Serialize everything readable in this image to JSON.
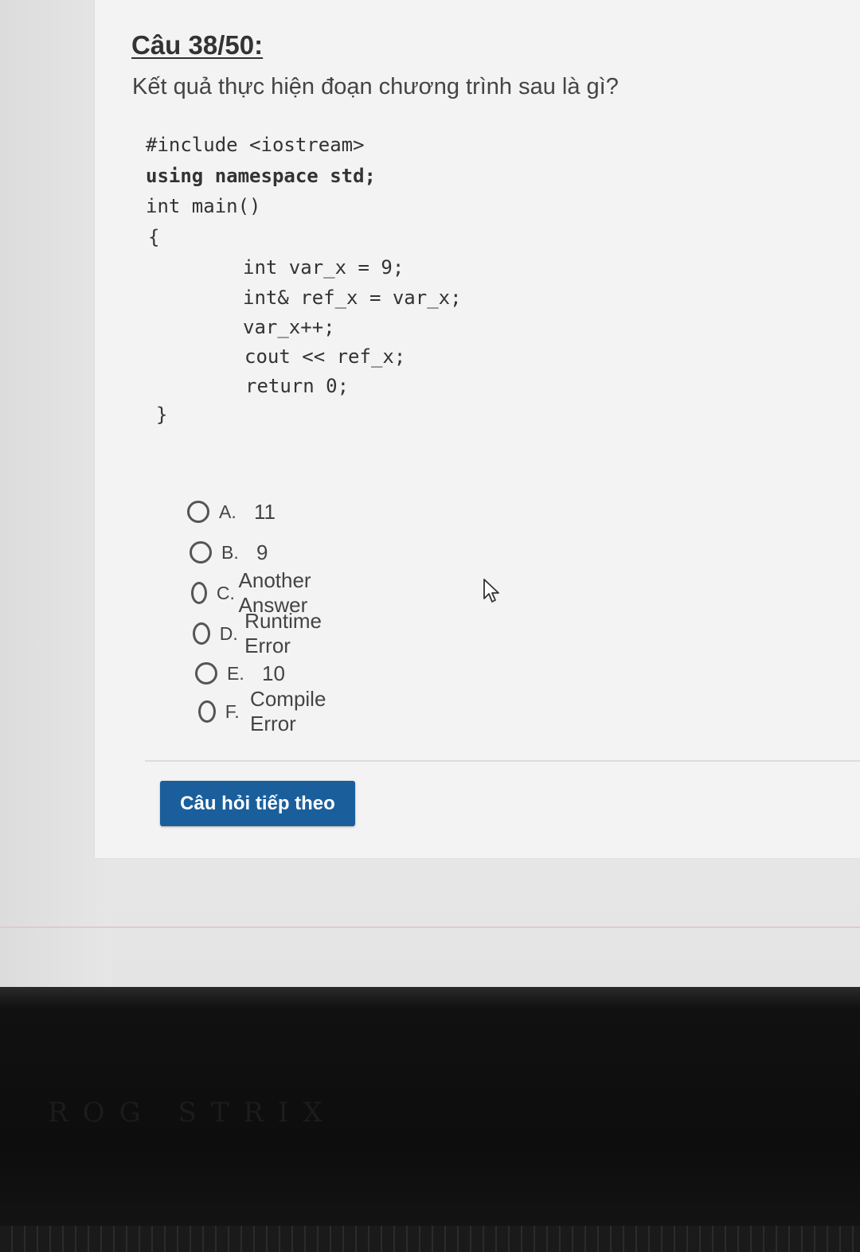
{
  "question": {
    "number": "Câu 38/50:",
    "text": "Kết quả thực hiện đoạn chương trình sau là gì?"
  },
  "code": {
    "line1": "#include <iostream>",
    "line2": "using namespace std;",
    "line3": "int main()",
    "line4": "{",
    "line5": "int var_x = 9;",
    "line6": "int& ref_x = var_x;",
    "line7": "var_x++;",
    "line8": "cout << ref_x;",
    "line9": "return 0;",
    "line10": "}"
  },
  "options": [
    {
      "letter": "A.",
      "text": "11"
    },
    {
      "letter": "B.",
      "text": "9"
    },
    {
      "letter": "C.",
      "text": "Another Answer"
    },
    {
      "letter": "D.",
      "text": "Runtime Error"
    },
    {
      "letter": "E.",
      "text": "10"
    },
    {
      "letter": "F.",
      "text": "Compile Error"
    }
  ],
  "next_button": "Câu hỏi tiếp theo",
  "bezel_logo": "ROG STRIX",
  "icons": {
    "cursor": "mouse-pointer-icon"
  }
}
